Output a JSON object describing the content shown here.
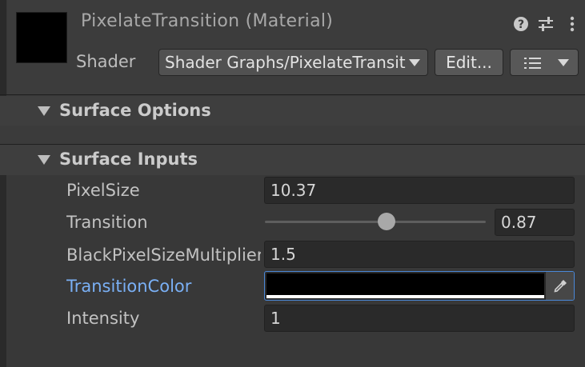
{
  "header": {
    "title": "PixelateTransition (Material)",
    "shader_label": "Shader",
    "shader_value": "Shader Graphs/PixelateTransition",
    "edit_label": "Edit...",
    "icons": [
      "help-icon",
      "preset-sliders-icon",
      "kebab-menu-icon",
      "list-icon",
      "chevron-down-icon"
    ]
  },
  "sections": {
    "surface_options": "Surface Options",
    "surface_inputs": "Surface Inputs"
  },
  "properties": {
    "pixel_size": {
      "label": "PixelSize",
      "value": "10.37"
    },
    "transition": {
      "label": "Transition",
      "value": "0.87",
      "slider_fraction": 0.55
    },
    "black_pixel": {
      "label": "BlackPixelSizeMultiplier",
      "value": "1.5"
    },
    "transition_color": {
      "label": "TransitionColor",
      "color": "#000000",
      "alpha": "#ffffff"
    },
    "intensity": {
      "label": "Intensity",
      "value": "1"
    }
  },
  "colors": {
    "accent": "#7ab0f5",
    "focus_border": "#4a88d8"
  }
}
